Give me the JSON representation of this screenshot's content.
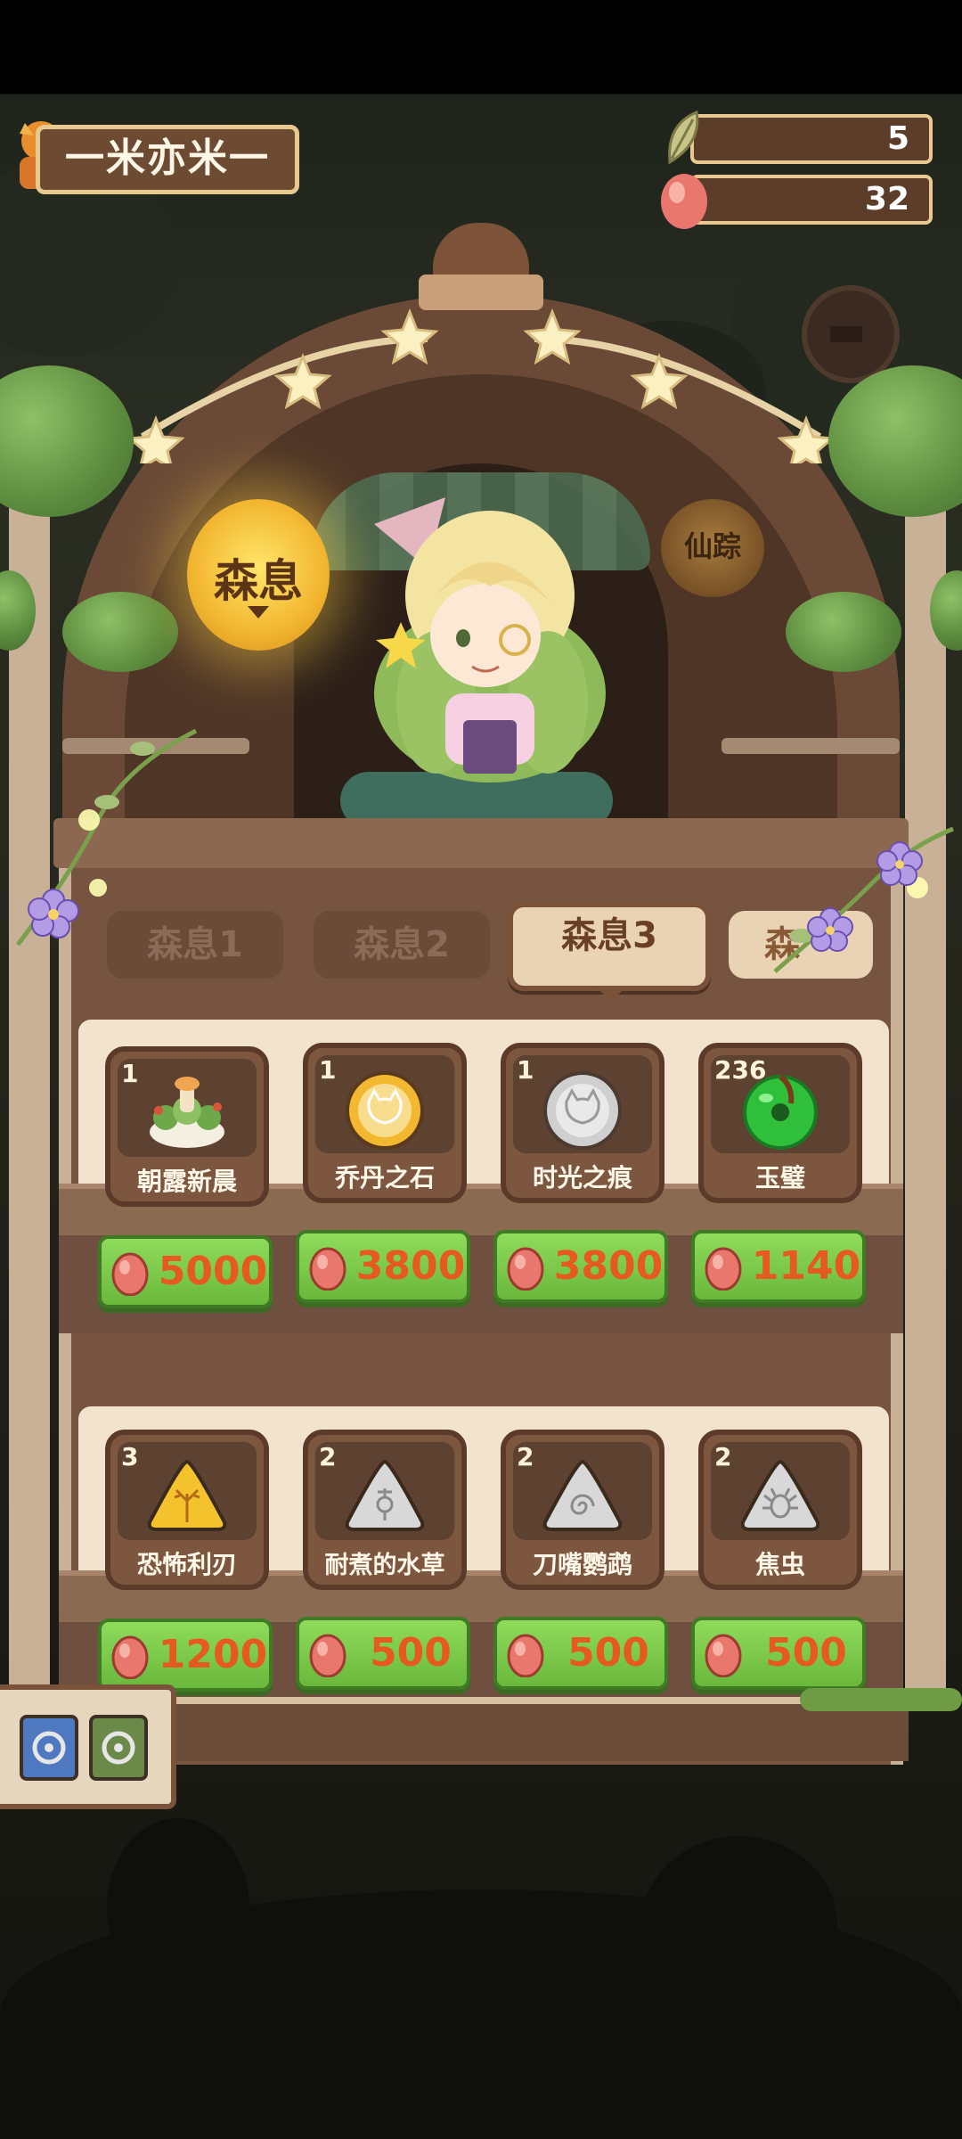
{
  "player": {
    "name": "一米亦米一"
  },
  "resources": {
    "leaf_count": "5",
    "egg_count": "32"
  },
  "lanterns": {
    "left": "森息",
    "right": "仙踪"
  },
  "tabs": [
    {
      "label": "森息1",
      "active": false
    },
    {
      "label": "森息2",
      "active": false
    },
    {
      "label": "森息3",
      "active": true
    },
    {
      "label": "森",
      "active": false
    }
  ],
  "shelves": [
    {
      "items": [
        {
          "count": "1",
          "name": "朝露新晨",
          "price": "5000",
          "icon": "dew-morning-icon"
        },
        {
          "count": "1",
          "name": "乔丹之石",
          "price": "3800",
          "icon": "gold-cat-coin-icon"
        },
        {
          "count": "1",
          "name": "时光之痕",
          "price": "3800",
          "icon": "silver-cat-coin-icon"
        },
        {
          "count": "236",
          "name": "玉璧",
          "price": "1140",
          "icon": "jade-disc-icon"
        }
      ]
    },
    {
      "items": [
        {
          "count": "3",
          "name": "恐怖利刃",
          "price": "1200",
          "icon": "gold-antler-triangle-icon"
        },
        {
          "count": "2",
          "name": "耐煮的水草",
          "price": "500",
          "icon": "silver-rune-triangle-icon"
        },
        {
          "count": "2",
          "name": "刀嘴鹦鹉",
          "price": "500",
          "icon": "silver-spiral-triangle-icon"
        },
        {
          "count": "2",
          "name": "焦虫",
          "price": "500",
          "icon": "silver-bug-triangle-icon"
        }
      ]
    }
  ],
  "colors": {
    "price_text": "#e65a1f",
    "price_bg": "#7fcf4c",
    "panel": "#765440",
    "active_tab": "#e9d3b4"
  }
}
